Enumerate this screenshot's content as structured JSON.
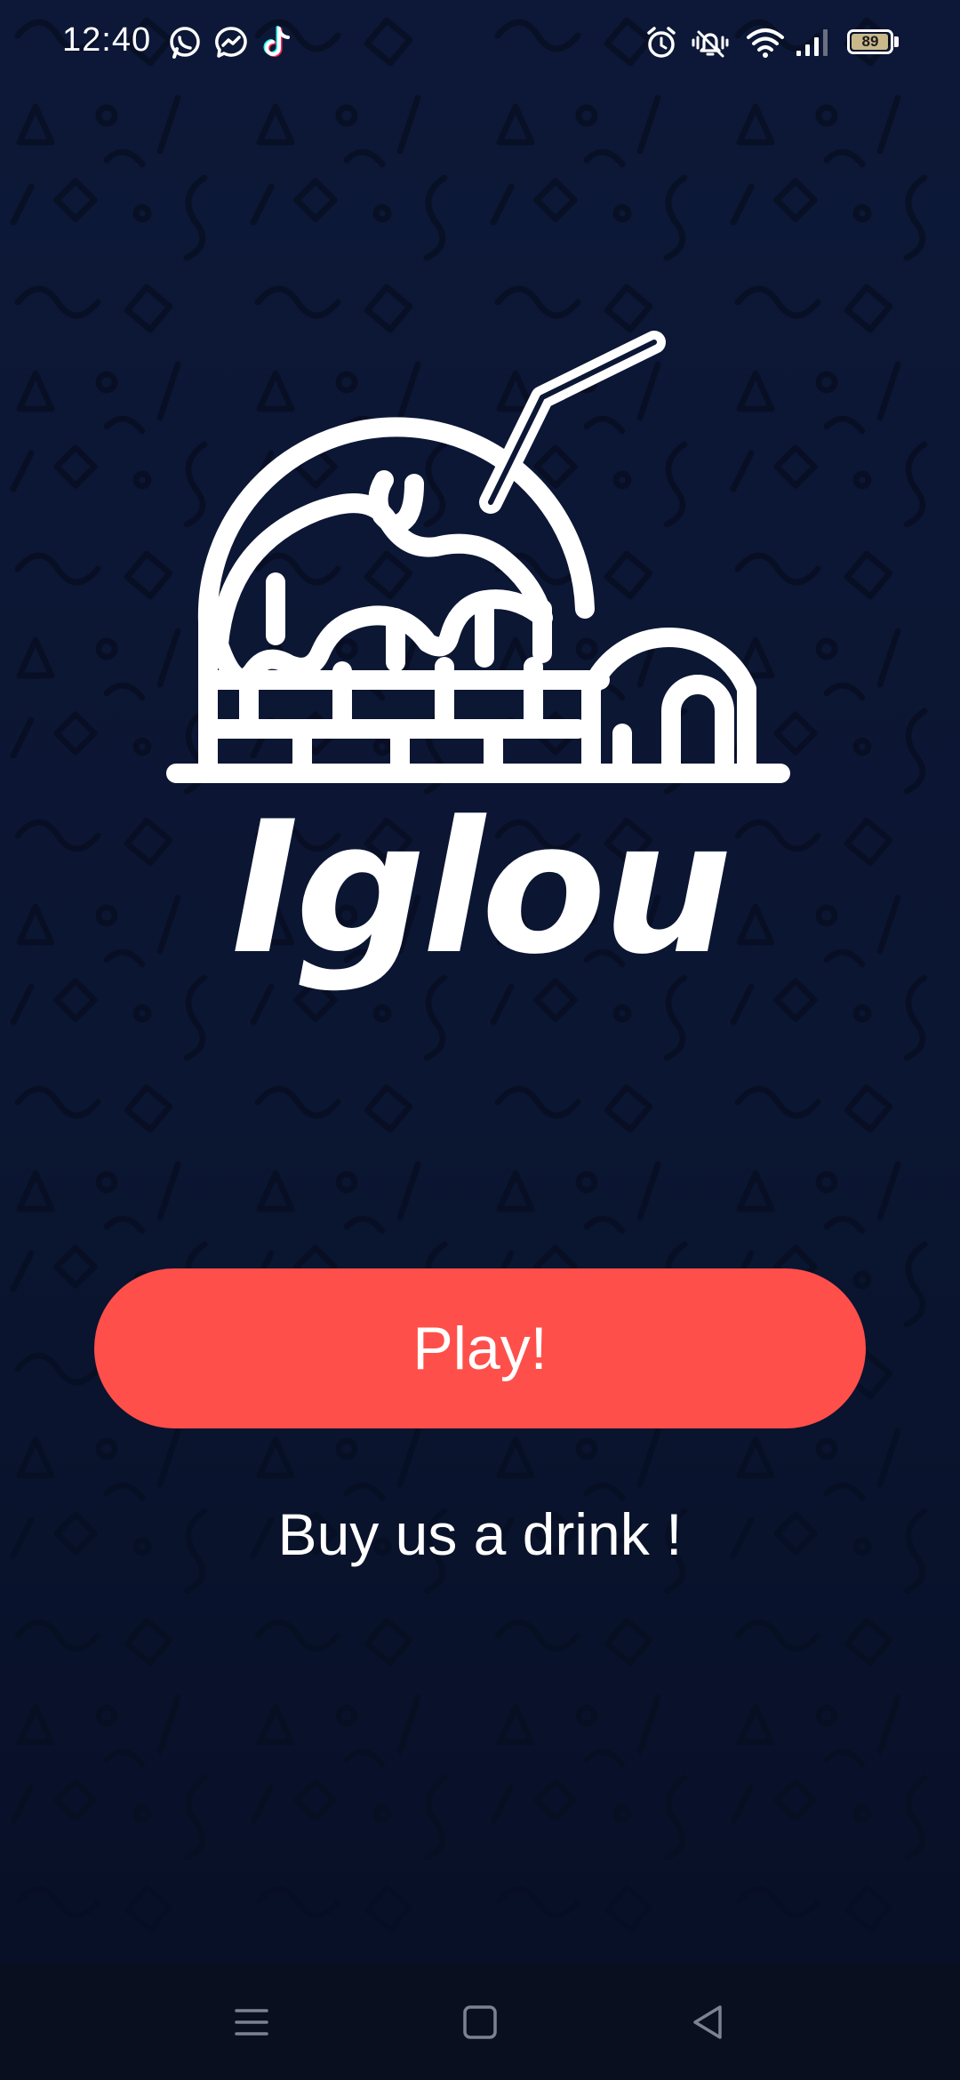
{
  "status_bar": {
    "time": "12:40",
    "notification_icons": [
      "whatsapp-icon",
      "messenger-icon",
      "tiktok-icon"
    ],
    "system_icons": [
      "alarm-icon",
      "vibrate-icon",
      "wifi-icon",
      "signal-icon"
    ],
    "battery_level": "89"
  },
  "app": {
    "logo_text": "Iglou",
    "play_label": "Play!",
    "drink_label": "Buy us a drink !"
  },
  "colors": {
    "background": "#0b1632",
    "accent": "#ff4f4a",
    "text": "#ffffff"
  },
  "nav_bar": {
    "buttons": [
      "menu-icon",
      "home-icon",
      "back-icon"
    ]
  }
}
